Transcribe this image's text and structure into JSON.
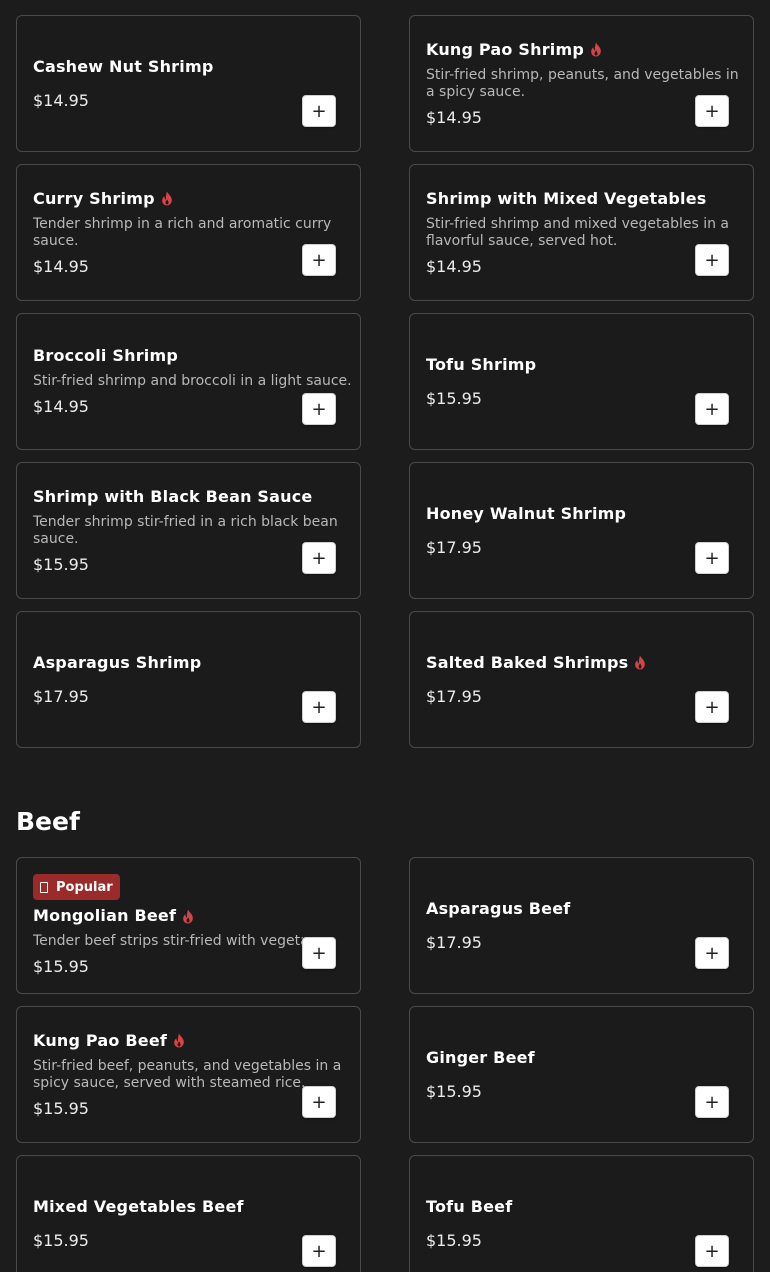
{
  "colors": {
    "background": "#1c1c1c",
    "card_border": "#4a4a4a",
    "spicy": "#d64545",
    "badge": "#9b2a2a"
  },
  "add_label": "+",
  "sections": [
    {
      "title": "",
      "items": [
        {
          "name": "Cashew Nut Shrimp",
          "description": "",
          "price": "$14.95",
          "spicy": false
        },
        {
          "name": "Kung Pao Shrimp",
          "description": "Stir-fried shrimp, peanuts, and vegetables in a spicy sauce.",
          "price": "$14.95",
          "spicy": true
        },
        {
          "name": "Curry Shrimp",
          "description": "Tender shrimp in a rich and aromatic curry sauce.",
          "price": "$14.95",
          "spicy": true
        },
        {
          "name": "Shrimp with Mixed Vegetables",
          "description": "Stir-fried shrimp and mixed vegetables in a flavorful sauce, served hot.",
          "price": "$14.95",
          "spicy": false
        },
        {
          "name": "Broccoli Shrimp",
          "description": "Stir-fried shrimp and broccoli in a light sauce.",
          "price": "$14.95",
          "spicy": false
        },
        {
          "name": "Tofu Shrimp",
          "description": "",
          "price": "$15.95",
          "spicy": false
        },
        {
          "name": "Shrimp with Black Bean Sauce",
          "description": "Tender shrimp stir-fried in a rich black bean sauce.",
          "price": "$15.95",
          "spicy": false
        },
        {
          "name": "Honey Walnut Shrimp",
          "description": "",
          "price": "$17.95",
          "spicy": false
        },
        {
          "name": "Asparagus Shrimp",
          "description": "",
          "price": "$17.95",
          "spicy": false
        },
        {
          "name": "Salted Baked Shrimps",
          "description": "",
          "price": "$17.95",
          "spicy": true
        }
      ]
    },
    {
      "title": "Beef",
      "items": [
        {
          "name": "Mongolian Beef",
          "description": "Tender beef strips stir-fried with vegetables",
          "price": "$15.95",
          "spicy": true,
          "badge": "Popular"
        },
        {
          "name": "Asparagus Beef",
          "description": "",
          "price": "$17.95",
          "spicy": false
        },
        {
          "name": "Kung Pao Beef",
          "description": "Stir-fried beef, peanuts, and vegetables in a spicy sauce, served with steamed rice.",
          "price": "$15.95",
          "spicy": true
        },
        {
          "name": "Ginger Beef",
          "description": "",
          "price": "$15.95",
          "spicy": false
        },
        {
          "name": "Mixed Vegetables Beef",
          "description": "",
          "price": "$15.95",
          "spicy": false
        },
        {
          "name": "Tofu Beef",
          "description": "",
          "price": "$15.95",
          "spicy": false
        }
      ]
    }
  ]
}
